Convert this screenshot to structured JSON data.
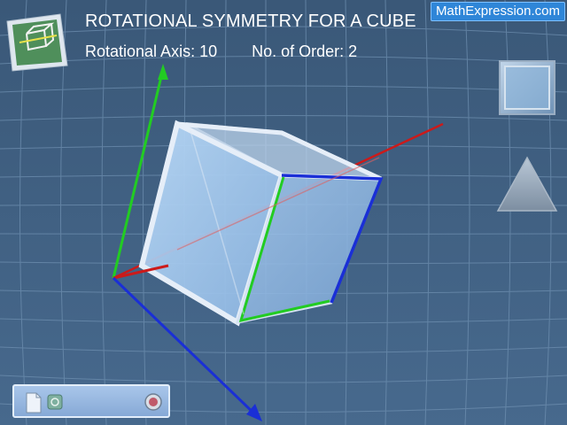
{
  "header": {
    "title": "ROTATIONAL SYMMETRY FOR A CUBE",
    "rotational_axis_text": "Rotational Axis: 10",
    "order_text": "No. of Order: 2",
    "brand": "MathExpression.com"
  },
  "icons": {
    "logo": "cube-logo-icon",
    "square": "square-shape-icon",
    "triangle": "triangle-shape-icon",
    "document": "document-icon",
    "animation": "animation-icon",
    "reset": "reset-icon"
  },
  "colors": {
    "background": "#3f5d7e",
    "grid": "#6e8fb0",
    "x_axis": "#cc1a1a",
    "y_axis": "#22cc22",
    "z_axis": "#1a2fd6",
    "cube_face": "#9ec6f0",
    "brand_bg": "#2f86d8"
  }
}
